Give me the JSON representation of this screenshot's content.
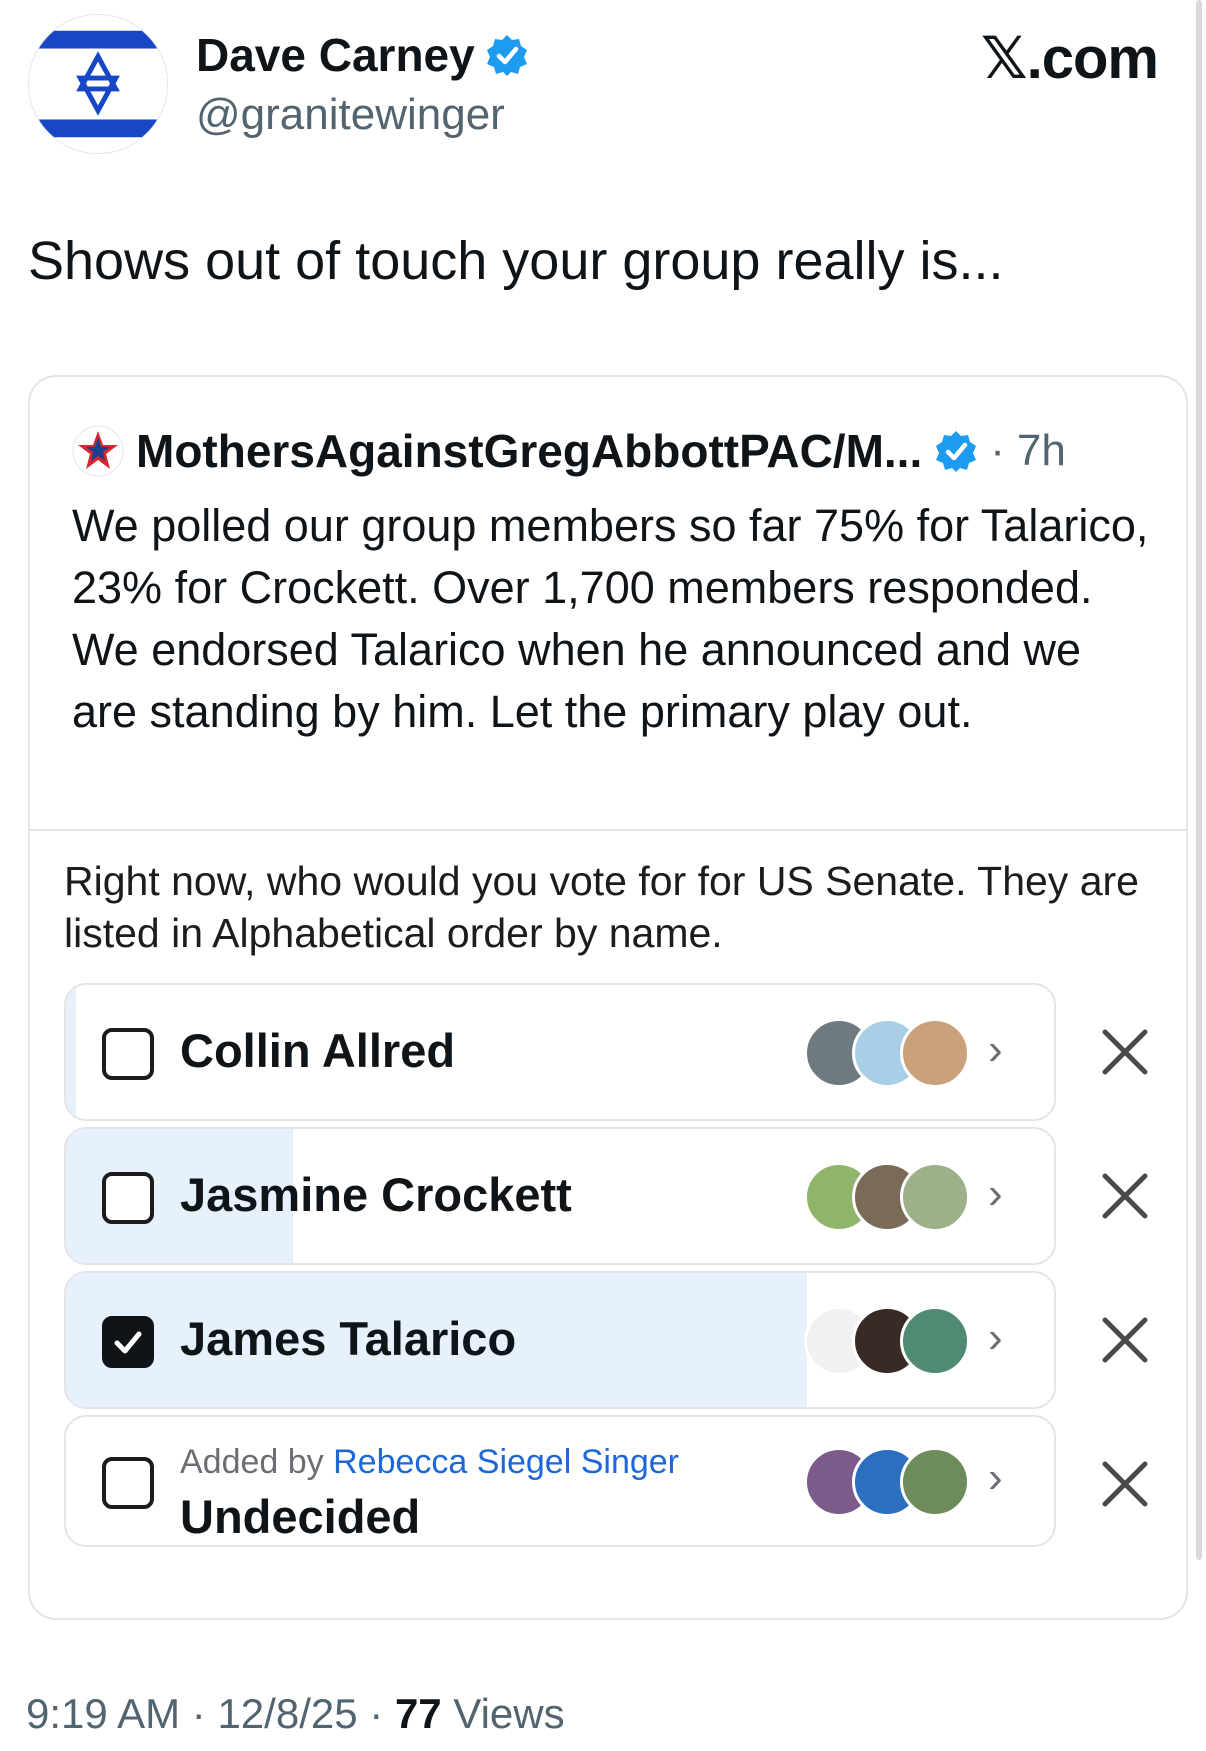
{
  "author": {
    "display_name": "Dave Carney",
    "handle": "@granitewinger",
    "avatar_icon": "israel-flag-icon",
    "verified": true
  },
  "brand": "𝕏.com",
  "tweet": {
    "text": "Shows out of touch your group really is..."
  },
  "quoted": {
    "name": "MothersAgainstGregAbbottPAC/M...",
    "separator": "·",
    "time": "7h",
    "logo_icon": "star-logo-icon",
    "text": "We polled our group members so far 75% for Talarico, 23% for Crockett. Over 1,700 members responded. We endorsed Talarico when he announced and we are standing by him.  Let the primary play out."
  },
  "poll": {
    "question": "Right now, who would you vote for for US Senate. They are listed in Alphabetical order by name.",
    "options": [
      {
        "label": "Collin Allred",
        "checked": false,
        "share": 0.01
      },
      {
        "label": "Jasmine Crockett",
        "checked": false,
        "share": 0.23
      },
      {
        "label": "James Talarico",
        "checked": true,
        "share": 0.75
      },
      {
        "label": "Undecided",
        "checked": false,
        "share": 0.0,
        "added_by_prefix": "Added by",
        "added_by_name": "Rebecca Siegel Singer"
      }
    ],
    "chevron": "›"
  },
  "footer": {
    "time": "9:19 AM",
    "sep1": "·",
    "date": "12/8/25",
    "sep2": "·",
    "views_count": "77",
    "views_label": "Views"
  },
  "colors": {
    "poll_fill": "#e6f1fb",
    "verified_blue": "#1d9bf0",
    "link_blue": "#1d67d6"
  }
}
